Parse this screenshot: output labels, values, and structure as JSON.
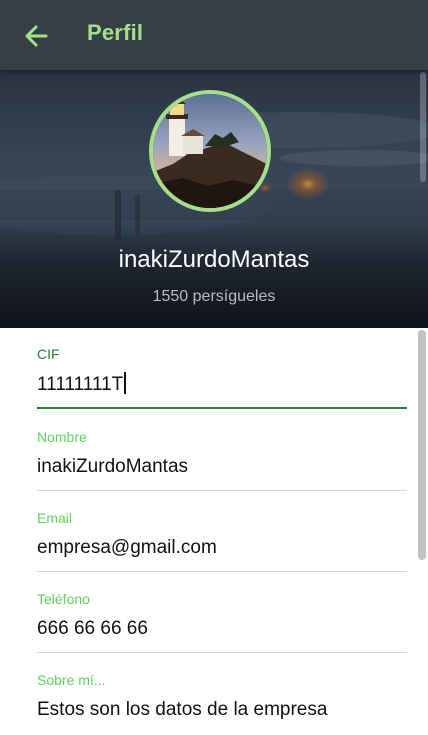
{
  "header": {
    "title": "Perfil",
    "back_icon": "arrow-left-icon",
    "title_color": "#a6df8a",
    "bar_color": "#353f48"
  },
  "profile": {
    "username": "inakiZurdoMantas",
    "followers": "1550 persígueles",
    "avatar_ring_color": "#a6df8a"
  },
  "form": {
    "fields": [
      {
        "label": "CIF",
        "value": "11111111T",
        "active": true
      },
      {
        "label": "Nombre",
        "value": "inakiZurdoMantas"
      },
      {
        "label": "Email",
        "value": "empresa@gmail.com"
      },
      {
        "label": "Teléfono",
        "value": "666 66 66 66"
      },
      {
        "label": "Sobre mí...",
        "value": "Estos son los datos de la empresa"
      }
    ],
    "active_label_color": "#2e7d32",
    "label_color": "#5fd35f"
  }
}
